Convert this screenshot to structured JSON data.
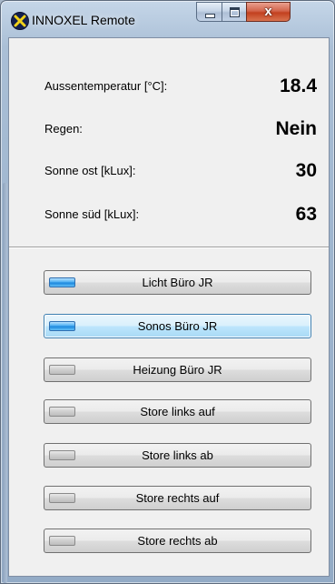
{
  "window": {
    "title": "INNOXEL Remote",
    "close_glyph": "x"
  },
  "sensors": [
    {
      "label": "Aussentemperatur [°C]:",
      "value": "18.4"
    },
    {
      "label": "Regen:",
      "value": "Nein"
    },
    {
      "label": "Sonne ost [kLux]:",
      "value": "30"
    },
    {
      "label": "Sonne süd [kLux]:",
      "value": "63"
    }
  ],
  "buttons": [
    {
      "label": "Licht Büro JR",
      "state": "on"
    },
    {
      "label": "Sonos Büro JR",
      "state": "on",
      "focused": true
    },
    {
      "label": "Heizung Büro JR",
      "state": "off"
    },
    {
      "label": "Store links auf",
      "state": "off"
    },
    {
      "label": "Store links ab",
      "state": "off"
    },
    {
      "label": "Store rechts auf",
      "state": "off"
    },
    {
      "label": "Store rechts ab",
      "state": "off"
    }
  ],
  "colors": {
    "indicator_on": "#1a86dc",
    "indicator_off": "#cfcfcf",
    "focus_border": "#3c7fb1",
    "close_button": "#c2401f"
  },
  "icons": {
    "app": "innoxel-x-icon",
    "minimize": "minimize-icon",
    "maximize": "maximize-icon",
    "close": "close-icon"
  }
}
